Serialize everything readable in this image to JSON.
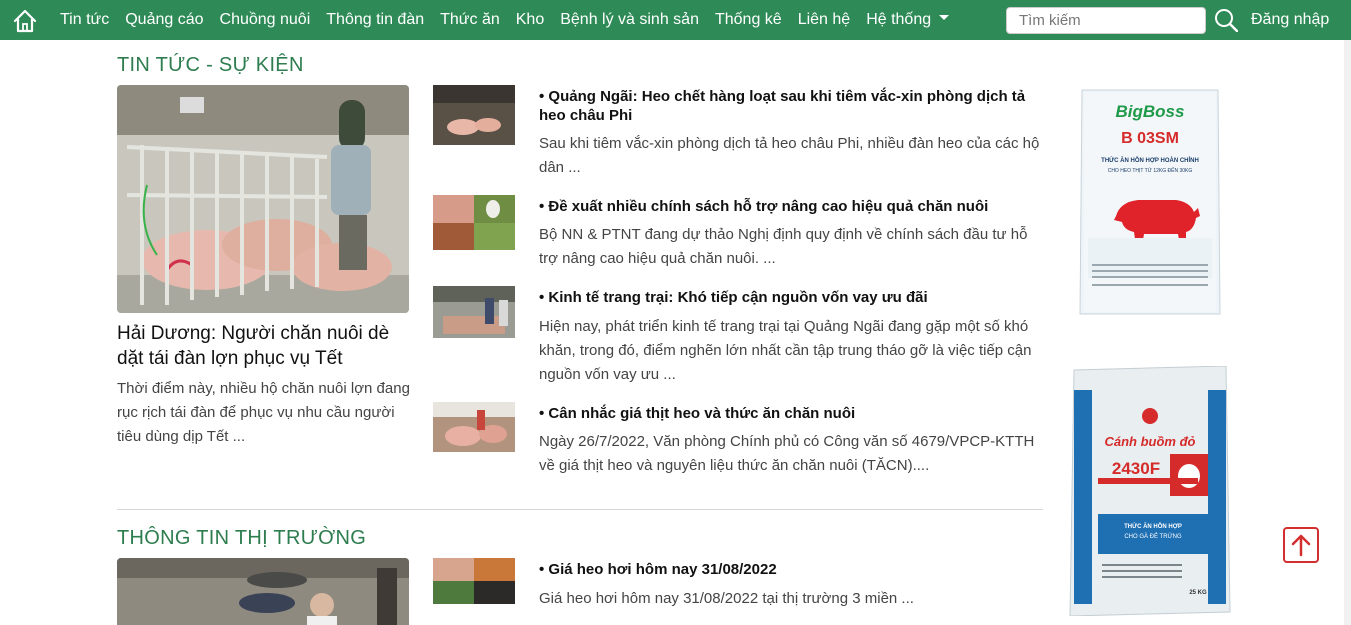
{
  "nav": {
    "items": [
      "Tin tức",
      "Quảng cáo",
      "Chuồng nuôi",
      "Thông tin đàn",
      "Thức ăn",
      "Kho",
      "Bệnh lý và sinh sản",
      "Thống kê",
      "Liên hệ",
      "Hệ thống"
    ],
    "search_placeholder": "Tìm kiếm",
    "login_label": "Đăng nhập",
    "home_icon": "home-icon",
    "search_icon": "search-icon",
    "color": "#2e8b57"
  },
  "news": {
    "heading": "TIN TỨC - SỰ KIỆN",
    "featured": {
      "title": "Hải Dương: Người chăn nuôi dè dặt tái đàn lợn phục vụ Tết",
      "desc": "Thời điểm này, nhiều hộ chăn nuôi lợn đang rục rịch tái đàn để phục vụ nhu cầu người tiêu dùng dịp Tết ..."
    },
    "items": [
      {
        "title": "• Quảng Ngãi: Heo chết hàng loạt sau khi tiêm vắc-xin phòng dịch tả heo châu Phi",
        "desc": "Sau khi tiêm vắc-xin phòng dịch tả heo châu Phi, nhiều đàn heo của các hộ dân ..."
      },
      {
        "title": "• Đề xuất nhiều chính sách hỗ trợ nâng cao hiệu quả chăn nuôi",
        "desc": "Bộ NN & PTNT đang dự thảo Nghị định quy định về chính sách đầu tư hỗ trợ nâng cao hiệu quả chăn nuôi. ..."
      },
      {
        "title": "• Kinh tế trang trại: Khó tiếp cận nguồn vốn vay ưu đãi",
        "desc": "Hiện nay, phát triển kinh tế trang trại tại Quảng Ngãi đang gặp một số khó khăn, trong đó, điểm nghẽn lớn nhất cần tập trung tháo gỡ là việc tiếp cận nguồn vốn vay ưu ..."
      },
      {
        "title": "• Cân nhắc giá thịt heo và thức ăn chăn nuôi",
        "desc": "Ngày 26/7/2022, Văn phòng Chính phủ có Công văn số 4679/VPCP-KTTH về giá thịt heo và nguyên liệu thức ăn chăn nuôi (TĂCN)...."
      }
    ]
  },
  "market": {
    "heading": "THÔNG TIN THỊ TRƯỜNG",
    "items": [
      {
        "title": "• Giá heo hơi hôm nay 31/08/2022",
        "desc": "Giá heo hơi hôm nay 31/08/2022 tại thị trường 3 miền ..."
      }
    ]
  },
  "ads": {
    "ad1": {
      "brand": "BigBoss",
      "code": "B 03SM",
      "line1": "THỨC ĂN HỖN HỢP HOÀN CHỈNH",
      "line2": "CHO HEO THỊT TỪ 12KG ĐẾN 30KG"
    },
    "ad2": {
      "brand": "Cánh buồm đỏ",
      "code": "2430F",
      "line1": "THỨC ĂN HỖN HỢP",
      "line2": "CHO GÀ ĐẺ TRỨNG",
      "weight": "25 KG"
    }
  },
  "back_to_top_icon": "arrow-up-icon"
}
